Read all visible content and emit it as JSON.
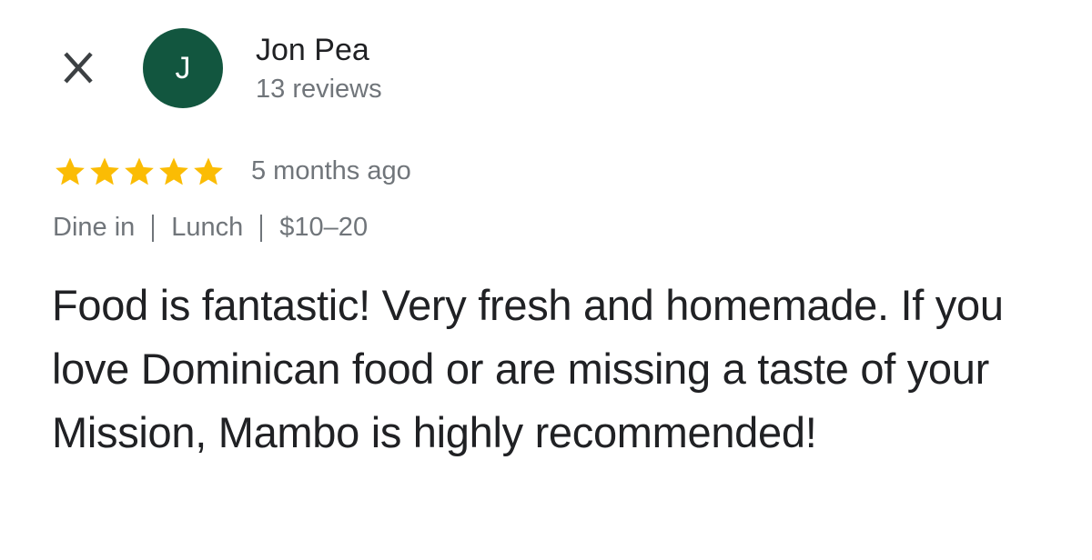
{
  "reviewer": {
    "avatar_initial": "J",
    "name": "Jon Pea",
    "review_count": "13 reviews"
  },
  "review": {
    "rating": 5,
    "rating_max": 5,
    "date": "5 months ago",
    "service_type": "Dine in",
    "meal_type": "Lunch",
    "price_range": "$10–20",
    "text": "Food is fantastic! Very fresh and homemade. If you love Dominican food or are missing a taste of your Mission, Mambo is highly recommended!"
  },
  "icons": {
    "close": "close-icon",
    "star": "star-icon"
  },
  "colors": {
    "avatar_bg": "#12563f",
    "star": "#fbbc04",
    "secondary_text": "#70757a",
    "primary_text": "#202124"
  }
}
